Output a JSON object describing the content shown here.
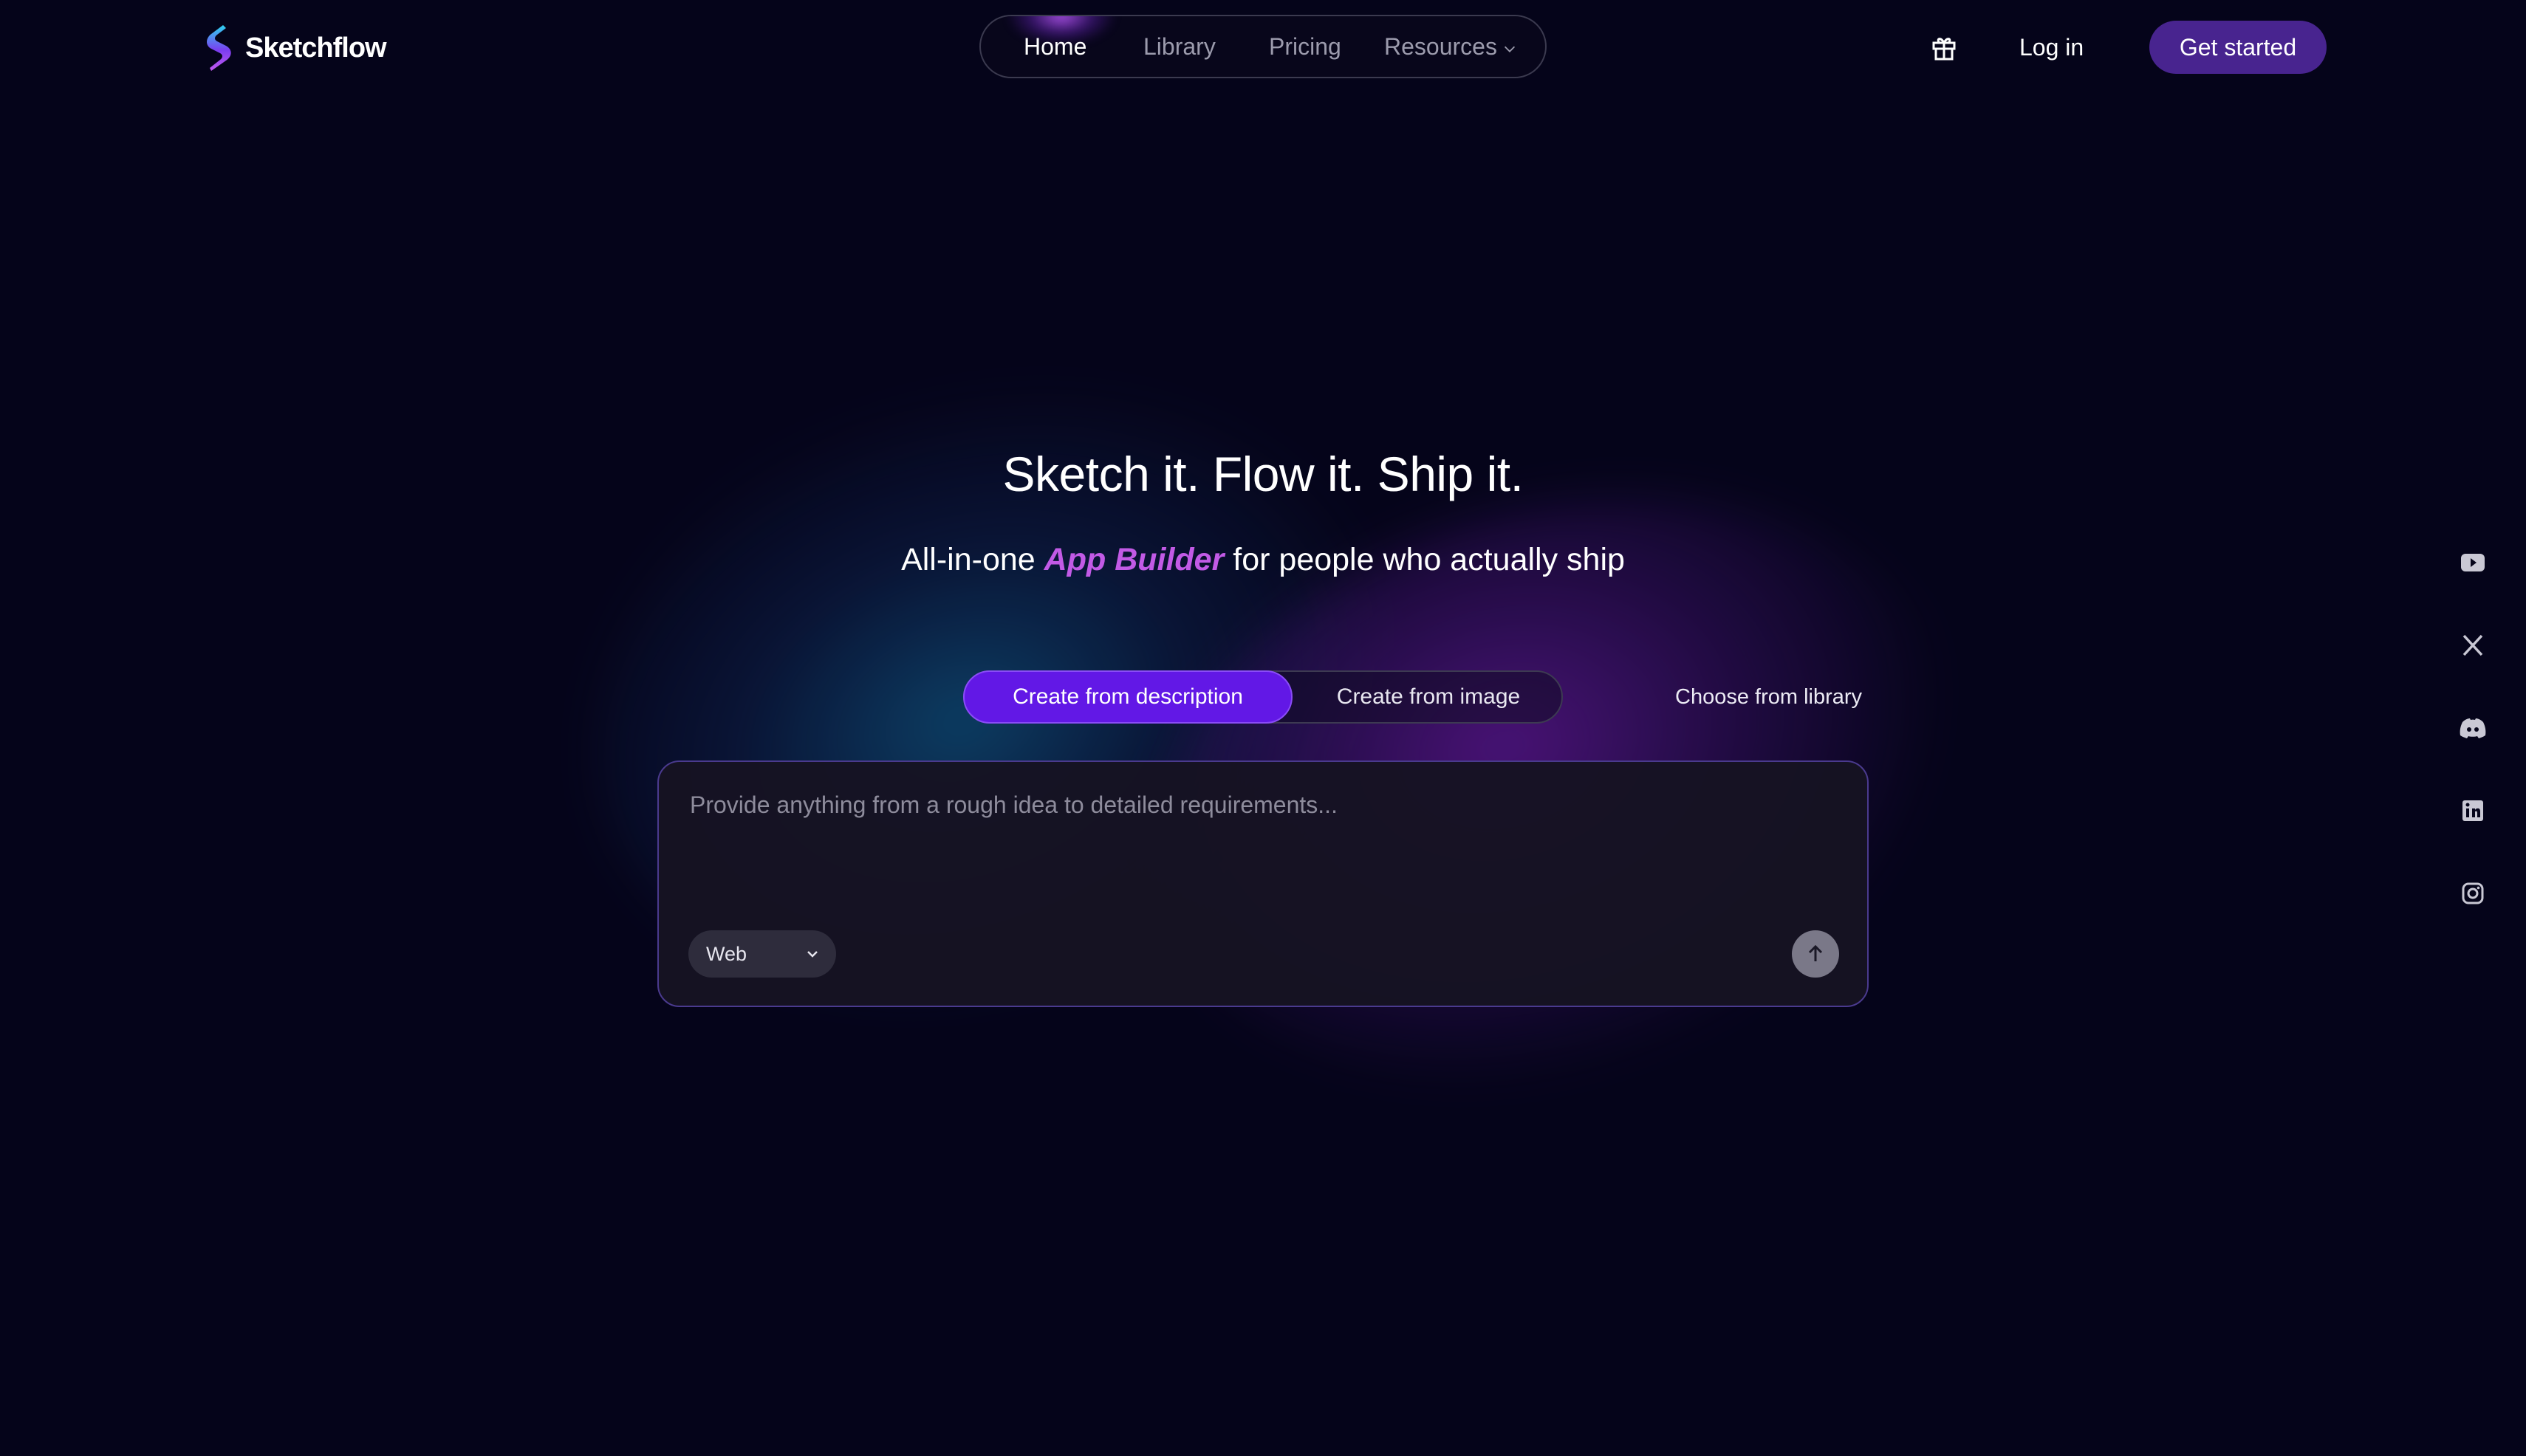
{
  "brand": {
    "name": "Sketchflow",
    "logo_icon": "sketchflow-s-logo",
    "gradient": [
      "#2dd4f0",
      "#7b3df0",
      "#c35af0"
    ]
  },
  "nav": {
    "items": [
      {
        "label": "Home",
        "active": true
      },
      {
        "label": "Library",
        "active": false
      },
      {
        "label": "Pricing",
        "active": false
      },
      {
        "label": "Resources",
        "active": false,
        "icon": "chevron-down-icon"
      }
    ]
  },
  "header": {
    "gift_icon": "gift-icon",
    "login_label": "Log in",
    "cta_label": "Get started",
    "cta_color": "#48248f"
  },
  "hero": {
    "title": "Sketch it. Flow it. Ship it.",
    "subtitle_before": "All-in-one ",
    "subtitle_accent": "App Builder",
    "subtitle_after": " for people who actually ship",
    "accent_color": "#c25ae6"
  },
  "tabs": {
    "items": [
      {
        "label": "Create from description",
        "active": true
      },
      {
        "label": "Create from image",
        "active": false
      }
    ],
    "active_color": "#6218e6"
  },
  "library_link": "Choose from library",
  "prompt": {
    "placeholder": "Provide anything from a rough idea to detailed requirements...",
    "value": "",
    "platform": "Web",
    "send_icon": "arrow-up-icon"
  },
  "social": [
    "youtube-icon",
    "x-icon",
    "discord-icon",
    "linkedin-icon",
    "instagram-icon"
  ]
}
